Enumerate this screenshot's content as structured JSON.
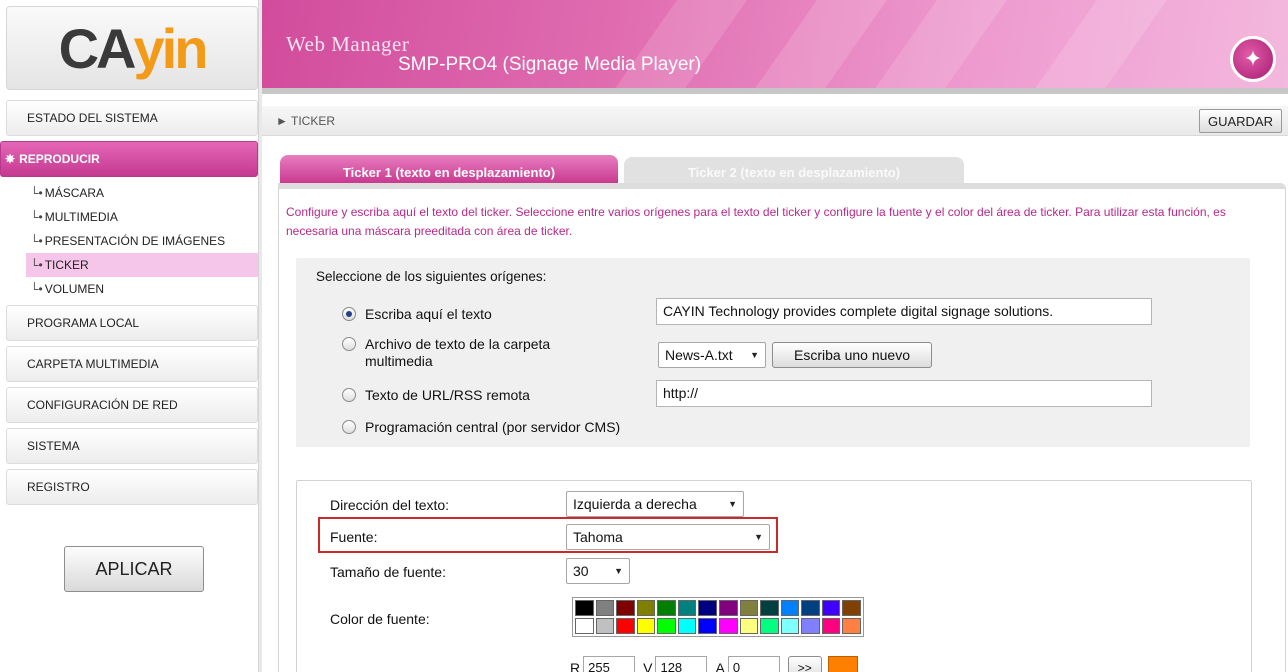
{
  "brand": {
    "logo_ca": "CA",
    "logo_yin": "yin",
    "colors": {
      "accent": "#c9398f",
      "logo_orange": "#f39a18"
    }
  },
  "header": {
    "label": "Web Manager",
    "product": "SMP-PRO4 (Signage Media Player)",
    "wand_icon": "magic-wand-icon"
  },
  "sidebar": {
    "items": [
      {
        "label": "ESTADO DEL SISTEMA"
      },
      {
        "label": "REPRODUCIR"
      },
      {
        "label": "PROGRAMA LOCAL"
      },
      {
        "label": "CARPETA MULTIMEDIA"
      },
      {
        "label": "CONFIGURACIÓN DE RED"
      },
      {
        "label": "SISTEMA"
      },
      {
        "label": "REGISTRO"
      }
    ],
    "sub_items": [
      {
        "label": "MÁSCARA"
      },
      {
        "label": "MULTIMEDIA"
      },
      {
        "label": "PRESENTACIÓN DE IMÁGENES"
      },
      {
        "label": "TICKER"
      },
      {
        "label": "VOLUMEN"
      }
    ],
    "apply_label": "APLICAR"
  },
  "breadcrumb": {
    "text": "► TICKER"
  },
  "toolbar": {
    "save_label": "GUARDAR"
  },
  "tabs": [
    {
      "label": "Ticker 1 (texto en desplazamiento)",
      "active": true
    },
    {
      "label": "Ticker 2 (texto en desplazamiento)",
      "active": false
    }
  ],
  "intro_text": "Configure y escriba aquí el texto del ticker. Seleccione entre varios orígenes para el texto del ticker y configure la fuente y el color del área de ticker. Para utilizar esta función, es necesaria una máscara preeditada con área de ticker.",
  "source": {
    "title": "Seleccione de los siguientes orígenes:",
    "options": [
      {
        "label": "Escriba aquí el texto",
        "checked": true
      },
      {
        "label": "Archivo de texto de la carpeta multimedia",
        "checked": false
      },
      {
        "label": "Texto de URL/RSS remota",
        "checked": false
      },
      {
        "label": "Programación central (por servidor CMS)",
        "checked": false
      }
    ],
    "text_value": "CAYIN Technology provides complete digital signage solutions.",
    "file_selected": "News-A.txt",
    "new_file_label": "Escriba uno nuevo",
    "url_value": "http://"
  },
  "format": {
    "direction_label": "Dirección del texto:",
    "direction_value": "Izquierda a derecha",
    "font_label": "Fuente:",
    "font_value": "Tahoma",
    "size_label": "Tamaño de fuente:",
    "size_value": "30",
    "color_label": "Color de fuente:",
    "palette_row1": [
      "#000000",
      "#808080",
      "#800000",
      "#808000",
      "#008000",
      "#008080",
      "#000080",
      "#800080",
      "#808040",
      "#004040",
      "#0080ff",
      "#004080",
      "#4000ff",
      "#804000"
    ],
    "palette_row2": [
      "#ffffff",
      "#c0c0c0",
      "#ff0000",
      "#ffff00",
      "#00ff00",
      "#00ffff",
      "#0000ff",
      "#ff00ff",
      "#ffff80",
      "#00ff80",
      "#80ffff",
      "#8080ff",
      "#ff0080",
      "#ff8040"
    ],
    "rgb": {
      "r_label": "R",
      "r_value": "255",
      "g_label": "V",
      "g_value": "128",
      "b_label": "A",
      "b_value": "0",
      "go_label": ">>",
      "preview_color": "#ff8000"
    }
  }
}
